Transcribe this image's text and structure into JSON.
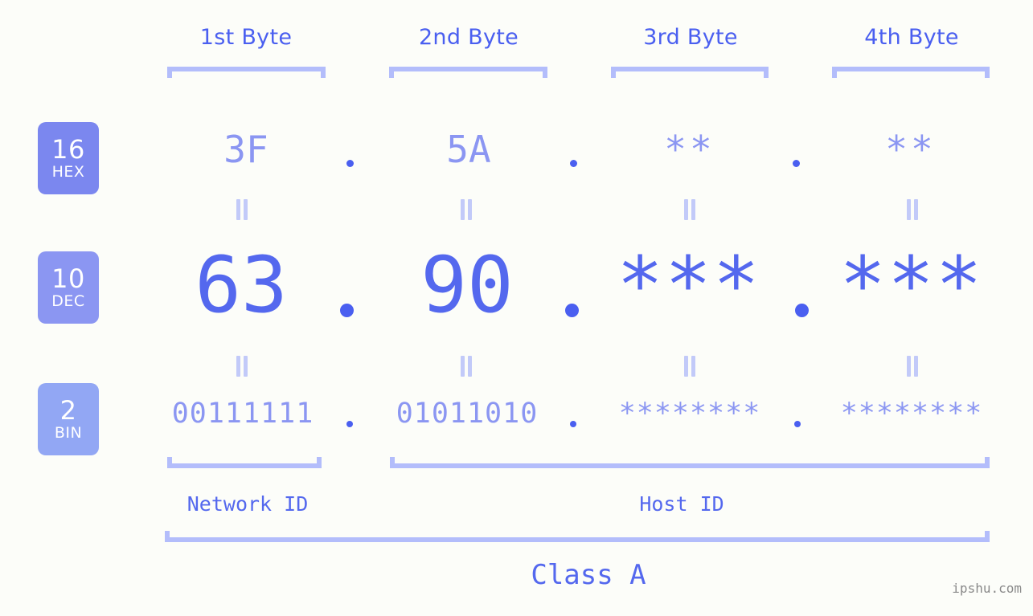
{
  "watermark": "ipshu.com",
  "byte_headers": [
    {
      "label": "1st Byte"
    },
    {
      "label": "2nd Byte"
    },
    {
      "label": "3rd Byte"
    },
    {
      "label": "4th Byte"
    }
  ],
  "radix_badges": [
    {
      "number": "16",
      "abbr": "HEX",
      "color": "#7b87ef"
    },
    {
      "number": "10",
      "abbr": "DEC",
      "color": "#8b96f2"
    },
    {
      "number": "2",
      "abbr": "BIN",
      "color": "#92a7f4"
    }
  ],
  "rows": {
    "hex": {
      "values": [
        "3F",
        "5A",
        "**",
        "**"
      ]
    },
    "dec": {
      "values": [
        "63",
        "90",
        "***",
        "***"
      ]
    },
    "bin": {
      "values": [
        "00111111",
        "01011010",
        "********",
        "********"
      ]
    }
  },
  "separators": {
    "dot": ".",
    "equals": "="
  },
  "id_labels": [
    {
      "label": "Network ID"
    },
    {
      "label": "Host ID"
    }
  ],
  "class_label": "Class A",
  "colors": {
    "background": "#fcfdf9",
    "accent_strong": "#4a5ff0",
    "accent_mid": "#5468ee",
    "accent_light": "#8b96f2",
    "bracket": "#b3bdfb",
    "equals": "#c2caf9",
    "watermark": "#8a8a8a"
  }
}
